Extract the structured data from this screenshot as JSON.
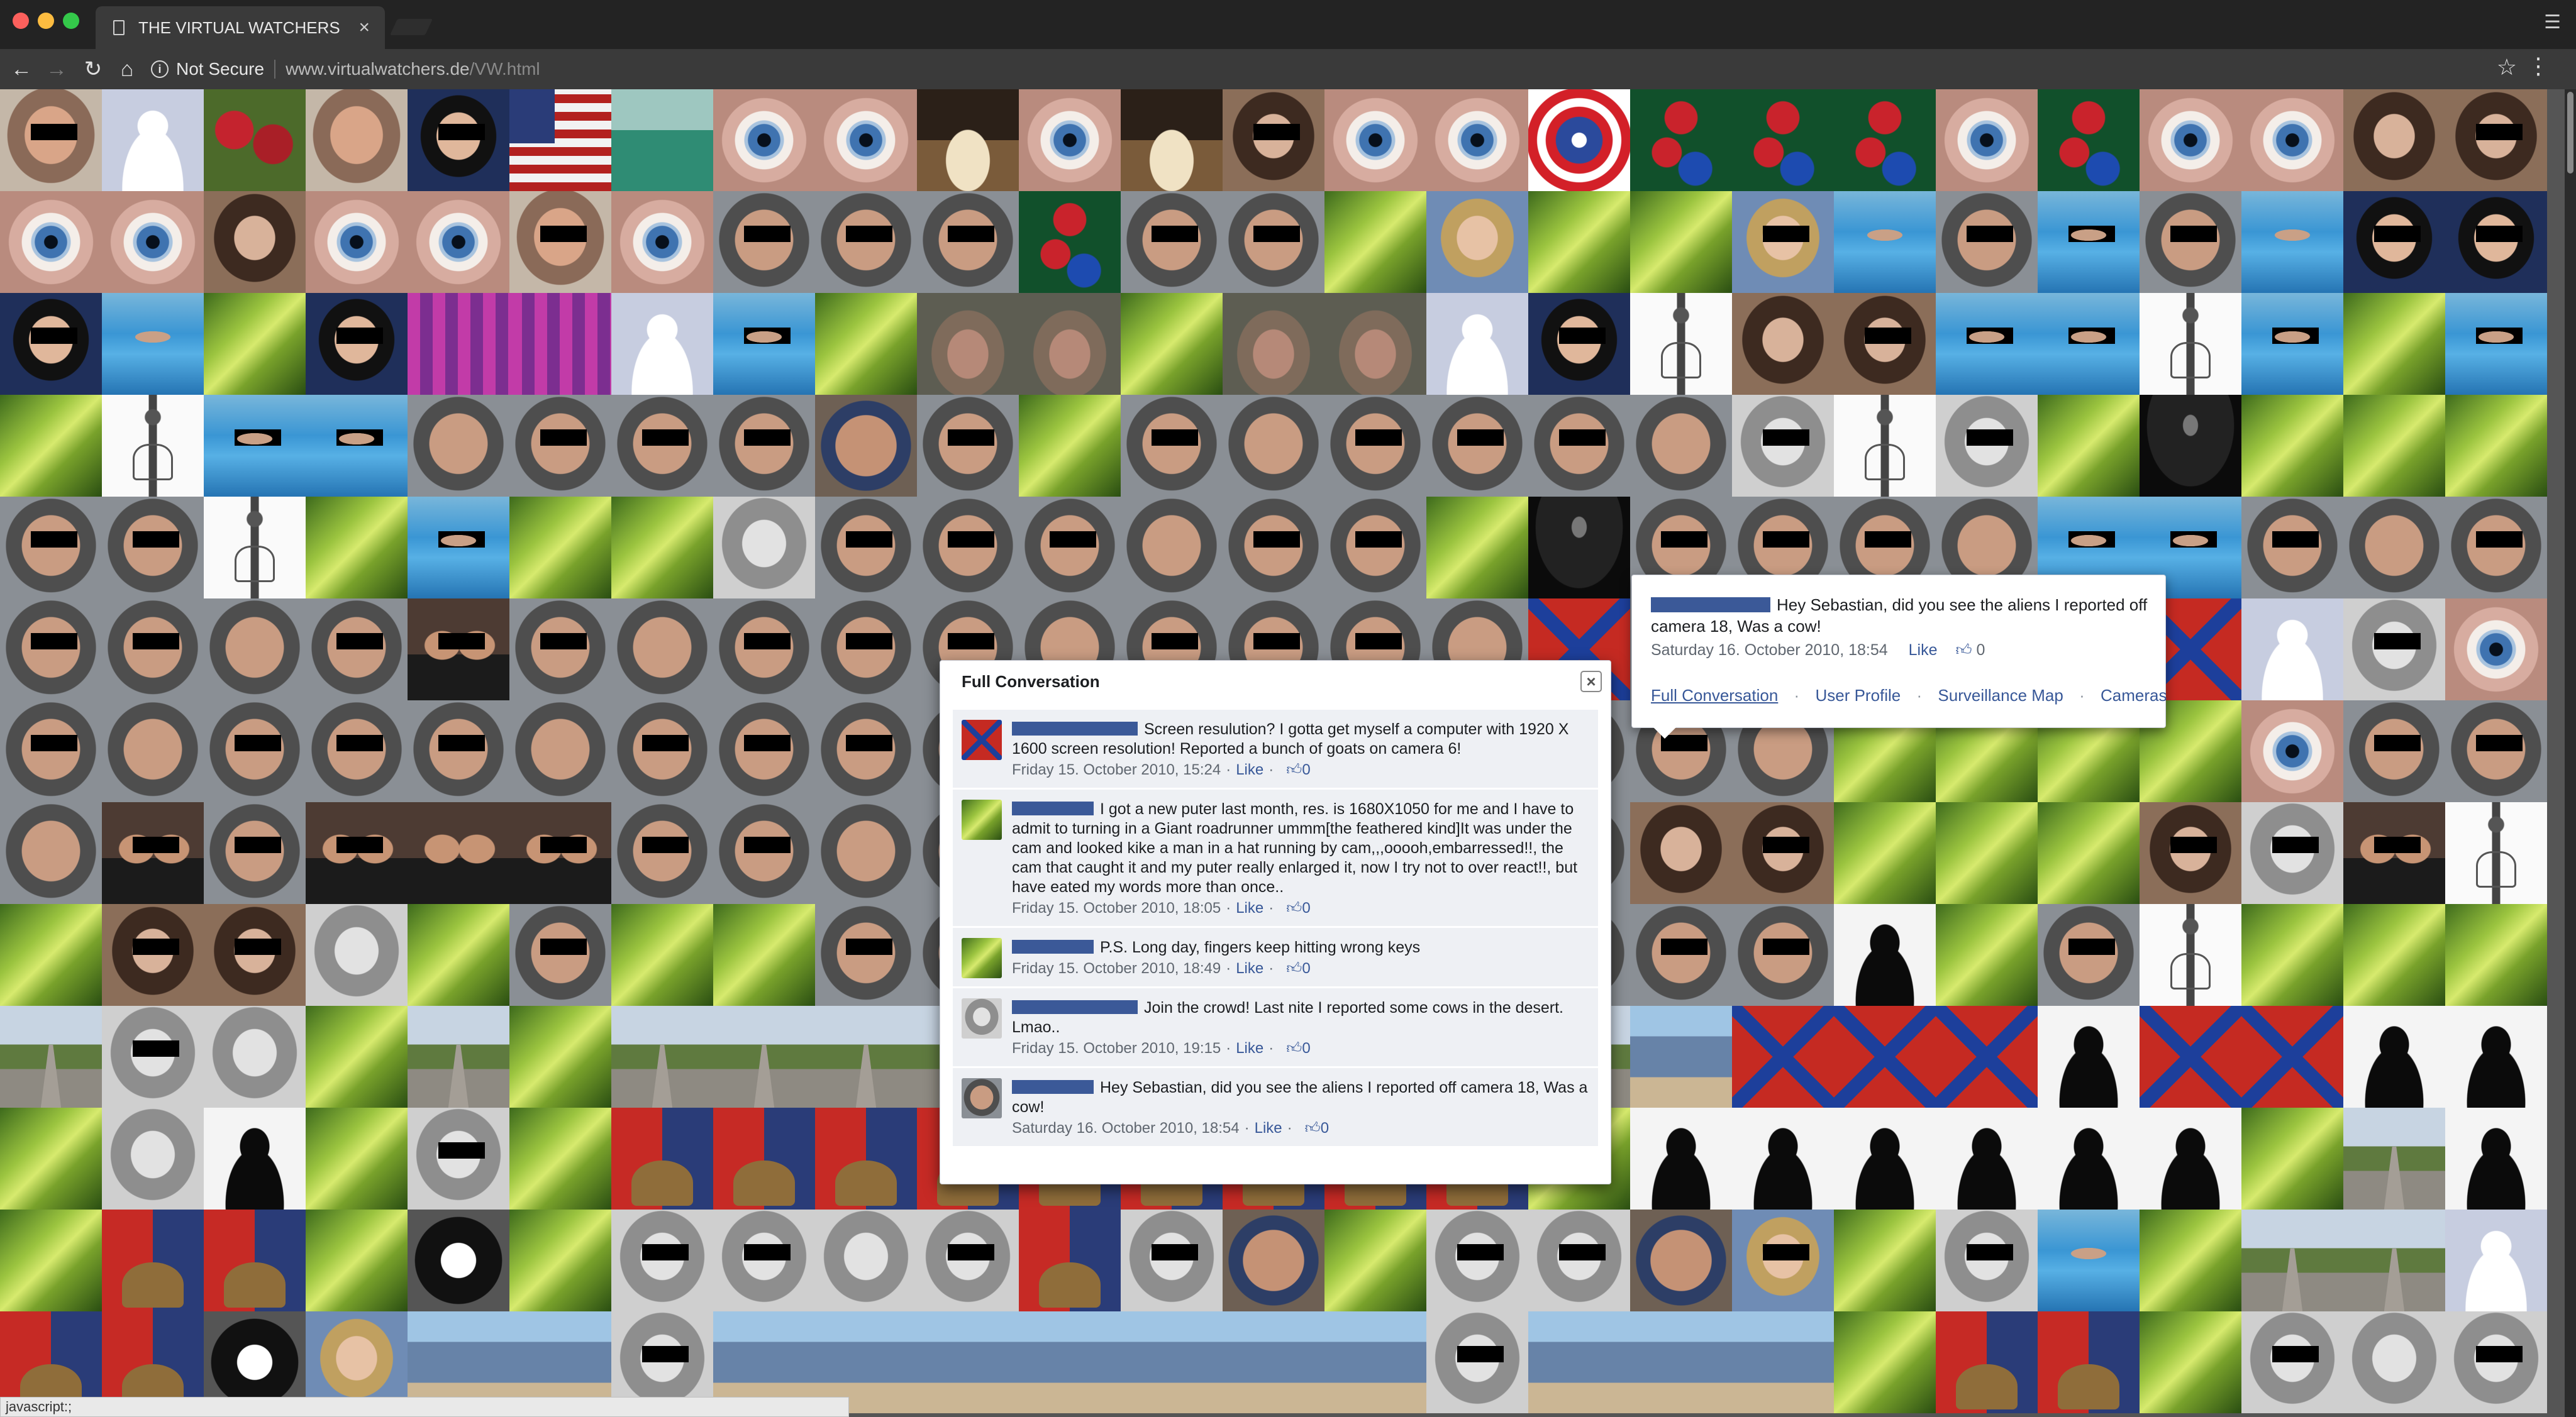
{
  "browser": {
    "tab_title": "THE VIRTUAL WATCHERS",
    "tab_close": "×",
    "security_label": "Not Secure",
    "url_host": "www.virtualwatchers.de",
    "url_path": "/VW.html",
    "status_text": "javascript:;"
  },
  "icons": {
    "back": "back-arrow-icon",
    "forward": "forward-arrow-icon",
    "reload": "reload-icon",
    "home": "home-icon",
    "info": "info-icon",
    "star": "bookmark-star-icon",
    "menu": "kebab-menu-icon",
    "thumb": "thumbs-up-icon",
    "close": "close-icon"
  },
  "wall": {
    "tile_kinds": [
      [
        "face",
        "blank",
        "roses",
        "face",
        "boy",
        "flag",
        "green",
        "eye",
        "eye",
        "cake",
        "eye",
        "cake",
        "woman",
        "eye",
        "eye",
        "shield",
        "chips",
        "chips",
        "chips",
        "eye",
        "chips",
        "eye",
        "eye",
        "woman",
        "woman"
      ],
      [
        "eye",
        "eye",
        "woman",
        "eye",
        "eye",
        "face",
        "eye",
        "bald",
        "bald",
        "bald",
        "chips",
        "bald",
        "bald",
        "leaf",
        "kid",
        "leaf",
        "leaf",
        "kid",
        "pool",
        "bald",
        "pool",
        "bald",
        "pool",
        "boy",
        "boy"
      ],
      [
        "boy",
        "pool",
        "leaf",
        "boy",
        "pink",
        "pink",
        "blank",
        "pool",
        "leaf",
        "donkey",
        "donkey",
        "leaf",
        "donkey",
        "donkey",
        "blank",
        "boy",
        "skel",
        "woman",
        "woman",
        "pool",
        "pool",
        "skel",
        "pool",
        "leaf",
        "pool"
      ],
      [
        "leaf",
        "skel",
        "pool",
        "pool",
        "bald",
        "bald",
        "bald",
        "bald",
        "fat",
        "bald",
        "leaf",
        "bald",
        "bald",
        "bald",
        "bald",
        "bald",
        "bald",
        "bw",
        "skel",
        "bw",
        "leaf",
        "dark",
        "leaf",
        "leaf",
        "leaf"
      ],
      [
        "bald",
        "bald",
        "skel",
        "leaf",
        "pool",
        "leaf",
        "leaf",
        "bw",
        "bald",
        "bald",
        "bald",
        "bald",
        "bald",
        "bald",
        "leaf",
        "dark",
        "bald",
        "bald",
        "bald",
        "bald",
        "pool",
        "pool",
        "bald",
        "bald",
        "bald"
      ],
      [
        "bald",
        "bald",
        "bald",
        "bald",
        "couple",
        "bald",
        "bald",
        "bald",
        "bald",
        "bald",
        "bald",
        "bald",
        "bald",
        "bald",
        "bald",
        "confed",
        "bald",
        "bald",
        "bald",
        "bald",
        "bald",
        "confed",
        "blank",
        "bw",
        "eye"
      ],
      [
        "bald",
        "bald",
        "bald",
        "bald",
        "bald",
        "bald",
        "bald",
        "bald",
        "bald",
        "bald",
        "bald",
        "bald",
        "bald",
        "bald",
        "bald",
        "bald",
        "bald",
        "bald",
        "leaf",
        "leaf",
        "leaf",
        "leaf",
        "eye",
        "bald",
        "bald"
      ],
      [
        "bald",
        "couple",
        "bald",
        "couple",
        "couple",
        "couple",
        "bald",
        "bald",
        "bald",
        "bald",
        "bald",
        "bald",
        "bald",
        "bald",
        "bald",
        "bald",
        "woman",
        "woman",
        "leaf",
        "leaf",
        "leaf",
        "woman",
        "bw",
        "couple",
        "skel"
      ],
      [
        "leaf",
        "woman",
        "woman",
        "bw",
        "leaf",
        "bald",
        "leaf",
        "leaf",
        "bald",
        "bald",
        "bald",
        "bald",
        "bald",
        "bald",
        "bald",
        "bald",
        "bald",
        "bald",
        "sil",
        "leaf",
        "bald",
        "skel",
        "leaf",
        "leaf",
        "leaf"
      ],
      [
        "road",
        "bw",
        "bw",
        "leaf",
        "road",
        "leaf",
        "road",
        "road",
        "road",
        "road",
        "road",
        "road",
        "road",
        "road",
        "road",
        "road",
        "group",
        "confed",
        "confed",
        "confed",
        "sil",
        "confed",
        "confed",
        "sil",
        "sil"
      ],
      [
        "leaf",
        "bw",
        "sil",
        "leaf",
        "bw",
        "leaf",
        "flags",
        "flags",
        "flags",
        "flags",
        "flags",
        "flags",
        "flags",
        "flags",
        "flags",
        "leaf",
        "sil",
        "sil",
        "sil",
        "sil",
        "sil",
        "sil",
        "leaf",
        "road",
        "sil"
      ],
      [
        "leaf",
        "flags",
        "flags",
        "leaf",
        "dog",
        "leaf",
        "bw",
        "bw",
        "bw",
        "bw",
        "flags",
        "bw",
        "fat",
        "leaf",
        "bw",
        "bw",
        "fat",
        "kid",
        "leaf",
        "bw",
        "pool",
        "leaf",
        "road",
        "road",
        "blank"
      ],
      [
        "flags",
        "flags",
        "dog",
        "kid",
        "group",
        "group",
        "bw",
        "group",
        "group",
        "group",
        "group",
        "group",
        "group",
        "group",
        "bw",
        "group",
        "group",
        "group",
        "leaf",
        "flags",
        "flags",
        "leaf",
        "bw",
        "bw",
        "bw"
      ]
    ],
    "masked_kinds": [
      "face",
      "bald",
      "boy",
      "woman",
      "bw",
      "fat",
      "couple",
      "kid",
      "pool"
    ]
  },
  "popup": {
    "message": "Hey Sebastian, did you see the aliens I reported off camera 18, Was a cow!",
    "timestamp": "Saturday 16. October 2010, 18:54",
    "like_label": "Like",
    "like_count": "0",
    "links": [
      "Full Conversation",
      "User Profile",
      "Surveillance Map",
      "Cameras"
    ],
    "separator": "·"
  },
  "conversation": {
    "title": "Full Conversation",
    "close_label": "×",
    "like_label": "Like",
    "separator": "·",
    "items": [
      {
        "avatar": "confed",
        "name_len": 200,
        "text": "Screen resulution? I gotta get myself a computer with 1920 X 1600 screen resolution! Reported a bunch of goats on camera 6!",
        "timestamp": "Friday 15. October 2010, 15:24",
        "likes": "0"
      },
      {
        "avatar": "leaf",
        "name_len": 130,
        "text": "I got a new puter last month, res. is 1680X1050 for me and I have to admit to turning in a Giant roadrunner ummm[the feathered kind]It was under the cam and looked kike a man in a hat running by cam,,,ooooh,embarressed!!, the cam that caught it and my puter really enlarged it, now I try not to over react!!, but have eated my words more than once..",
        "timestamp": "Friday 15. October 2010, 18:05",
        "likes": "0"
      },
      {
        "avatar": "leaf",
        "name_len": 130,
        "text": "P.S. Long day, fingers keep hitting wrong keys",
        "timestamp": "Friday 15. October 2010, 18:49",
        "likes": "0"
      },
      {
        "avatar": "bw",
        "name_len": 200,
        "text": "Join the crowd! Last nite I reported some cows in the desert. Lmao..",
        "timestamp": "Friday 15. October 2010, 19:15",
        "likes": "0"
      },
      {
        "avatar": "bald",
        "name_len": 130,
        "text": "Hey Sebastian, did you see the aliens I reported off camera 18, Was a cow!",
        "timestamp": "Saturday 16. October 2010, 18:54",
        "likes": "0"
      }
    ]
  }
}
